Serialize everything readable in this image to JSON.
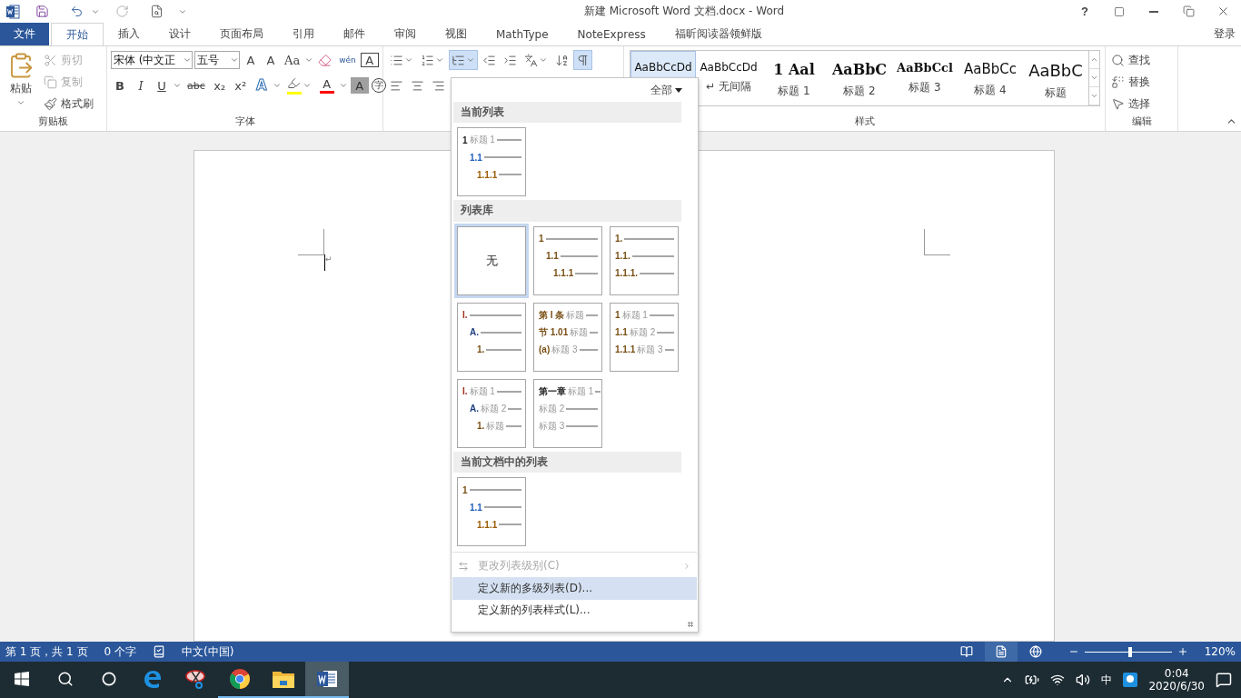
{
  "title_bar": {
    "title": "新建 Microsoft Word 文档.docx - Word",
    "help": "?"
  },
  "tabs": [
    {
      "label": "文件",
      "kind": "file",
      "selected": false
    },
    {
      "label": "开始",
      "kind": "tab",
      "selected": true
    },
    {
      "label": "插入",
      "kind": "tab",
      "selected": false
    },
    {
      "label": "设计",
      "kind": "tab",
      "selected": false
    },
    {
      "label": "页面布局",
      "kind": "tab",
      "selected": false
    },
    {
      "label": "引用",
      "kind": "tab",
      "selected": false
    },
    {
      "label": "邮件",
      "kind": "tab",
      "selected": false
    },
    {
      "label": "审阅",
      "kind": "tab",
      "selected": false
    },
    {
      "label": "视图",
      "kind": "tab",
      "selected": false
    },
    {
      "label": "MathType",
      "kind": "tab",
      "selected": false
    },
    {
      "label": "NoteExpress",
      "kind": "tab",
      "selected": false
    },
    {
      "label": "福昕阅读器领鲜版",
      "kind": "tab",
      "selected": false
    }
  ],
  "sign_in": "登录",
  "clipboard": {
    "label": "剪贴板",
    "paste": "粘贴",
    "buttons": [
      {
        "label": "剪切",
        "kind": "cut",
        "disabled": true
      },
      {
        "label": "复制",
        "kind": "copy",
        "disabled": true
      },
      {
        "label": "格式刷",
        "kind": "painter",
        "disabled": false
      }
    ]
  },
  "font": {
    "label": "字体",
    "font_name": "宋体 (中文正",
    "font_size": "五号",
    "row1": [
      {
        "label": "A",
        "kind": "grow"
      },
      {
        "label": "A",
        "kind": "shrink"
      },
      {
        "label": "Aa",
        "kind": "case"
      },
      {
        "kind": "clear"
      },
      {
        "label": "wén",
        "kind": "phonetic"
      },
      {
        "label": "A",
        "kind": "border"
      }
    ],
    "row2": [
      {
        "label": "B",
        "kind": "bold"
      },
      {
        "label": "I",
        "kind": "italic"
      },
      {
        "label": "U",
        "kind": "underline"
      },
      {
        "label": "abc",
        "kind": "strike"
      },
      {
        "label": "x₂",
        "kind": "sub"
      },
      {
        "label": "x²",
        "kind": "sup"
      },
      {
        "label": "A",
        "kind": "effect"
      },
      {
        "kind": "highlight"
      },
      {
        "label": "A",
        "kind": "color"
      },
      {
        "label": "A",
        "kind": "shading"
      },
      {
        "label": "字",
        "kind": "enclose"
      }
    ]
  },
  "paragraph": {
    "row1": [
      {
        "kind": "bullets",
        "active": false
      },
      {
        "kind": "numbering",
        "active": false
      },
      {
        "kind": "multilevel",
        "active": true
      },
      {
        "kind": "outdent",
        "active": false
      },
      {
        "kind": "indent",
        "active": false
      },
      {
        "kind": "asian",
        "active": false
      },
      {
        "kind": "sort",
        "active": false
      },
      {
        "kind": "marks",
        "active": true
      }
    ],
    "row2": [
      {
        "kind": "left",
        "active": false
      },
      {
        "kind": "center",
        "active": false
      },
      {
        "kind": "right",
        "active": false
      }
    ]
  },
  "styles": {
    "label": "样式",
    "items": [
      {
        "preview": "AaBbCcDd",
        "kind": "normal",
        "selected": true
      },
      {
        "preview": "AaBbCcDd",
        "name": "↵ 无间隔",
        "kind": "normal",
        "selected": false
      },
      {
        "preview": "1 Aal",
        "name": "标题 1",
        "kind": "h1",
        "selected": false
      },
      {
        "preview": "AaBbC",
        "name": "标题 2",
        "kind": "h2",
        "selected": false
      },
      {
        "preview": "AaBbCcl",
        "name": "标题 3",
        "kind": "h3",
        "selected": false
      },
      {
        "preview": "AaBbCc",
        "name": "标题 4",
        "kind": "h4",
        "selected": false
      },
      {
        "preview": "AaBbC",
        "name": "标题",
        "kind": "title",
        "selected": false
      }
    ]
  },
  "editing": {
    "label": "编辑",
    "buttons": [
      {
        "label": "查找",
        "kind": "find"
      },
      {
        "label": "替换",
        "kind": "replace"
      },
      {
        "label": "选择",
        "kind": "select"
      }
    ]
  },
  "document": {
    "paragraph_mark": "↵"
  },
  "multilevel_menu": {
    "filter": "全部",
    "sections": [
      {
        "title": "当前列表",
        "items": [
          {
            "kind": "indented",
            "selected": false,
            "lines": [
              {
                "number": "1",
                "label": "标题 1",
                "color": "#222222"
              },
              {
                "number": "1.1",
                "color": "#1f5fbf"
              },
              {
                "number": "1.1.1",
                "color": "#9a5a00"
              }
            ]
          }
        ]
      },
      {
        "title": "列表库",
        "items": [
          {
            "kind": "none",
            "text": "无",
            "selected": true
          },
          {
            "kind": "indented",
            "selected": false,
            "lines": [
              {
                "number": "1",
                "color": "#7a4f14"
              },
              {
                "number": "1.1",
                "color": "#7a4f14"
              },
              {
                "number": "1.1.1",
                "color": "#7a4f14"
              }
            ]
          },
          {
            "kind": "flush",
            "selected": false,
            "lines": [
              {
                "number": "1.",
                "color": "#7a4f14"
              },
              {
                "number": "1.1.",
                "color": "#7a4f14"
              },
              {
                "number": "1.1.1.",
                "color": "#7a4f14"
              }
            ]
          },
          {
            "kind": "indented",
            "selected": false,
            "lines": [
              {
                "number": "I.",
                "color": "#a03020"
              },
              {
                "number": "A.",
                "color": "#1f3f7f"
              },
              {
                "number": "1.",
                "color": "#7a4f14"
              }
            ]
          },
          {
            "kind": "flush",
            "selected": false,
            "lines": [
              {
                "number": "第 I 条",
                "label": "标题",
                "color": "#7a4f14"
              },
              {
                "number": "节 1.01",
                "label": "标题",
                "color": "#7a4f14"
              },
              {
                "number": "(a)",
                "label": "标题 3",
                "color": "#7a4f14"
              }
            ]
          },
          {
            "kind": "flush",
            "selected": false,
            "lines": [
              {
                "number": "1",
                "label": "标题 1",
                "color": "#7a4f14"
              },
              {
                "number": "1.1",
                "label": "标题 2",
                "color": "#7a4f14"
              },
              {
                "number": "1.1.1",
                "label": "标题 3",
                "color": "#7a4f14"
              }
            ]
          },
          {
            "kind": "indented",
            "selected": false,
            "lines": [
              {
                "number": "I.",
                "label": "标题 1",
                "color": "#a03020"
              },
              {
                "number": "A.",
                "label": "标题 2",
                "color": "#1f3f7f"
              },
              {
                "number": "1.",
                "label": "标题",
                "color": "#7a4f14"
              }
            ]
          },
          {
            "kind": "flush",
            "selected": false,
            "lines": [
              {
                "number": "第一章",
                "label": "标题 1",
                "color": "#222222"
              },
              {
                "label": "标题 2"
              },
              {
                "label": "标题 3"
              }
            ]
          }
        ]
      },
      {
        "title": "当前文档中的列表",
        "items": [
          {
            "kind": "indented",
            "selected": false,
            "lines": [
              {
                "number": "1",
                "color": "#7a4f14"
              },
              {
                "number": "1.1",
                "color": "#1f5fbf"
              },
              {
                "number": "1.1.1",
                "color": "#9a5a00"
              }
            ]
          }
        ]
      }
    ],
    "commands": [
      {
        "label": "更改列表级别(C)",
        "kind": "level",
        "disabled": true,
        "submenu": true,
        "selected": false
      },
      {
        "label": "定义新的多级列表(D)...",
        "kind": "plain",
        "disabled": false,
        "submenu": false,
        "selected": true
      },
      {
        "label": "定义新的列表样式(L)...",
        "kind": "plain",
        "disabled": false,
        "submenu": false,
        "selected": false
      }
    ]
  },
  "status_bar": {
    "page": "第 1 页，共 1 页",
    "words": "0 个字",
    "language": "中文(中国)",
    "views": [
      {
        "kind": "read",
        "selected": false
      },
      {
        "kind": "print",
        "selected": true
      },
      {
        "kind": "web",
        "selected": false
      }
    ],
    "zoom": {
      "level": 0.52,
      "reading": "120%"
    }
  },
  "taskbar": {
    "apps": [
      {
        "kind": "edge",
        "running": false,
        "active": false
      },
      {
        "kind": "snip",
        "running": false,
        "active": false
      },
      {
        "kind": "chrome",
        "running": true,
        "active": false
      },
      {
        "kind": "folder",
        "running": true,
        "active": false
      },
      {
        "kind": "word",
        "running": true,
        "active": true
      }
    ],
    "tray": {
      "ime": "中",
      "time": "0:04",
      "date": "2020/6/30"
    }
  }
}
